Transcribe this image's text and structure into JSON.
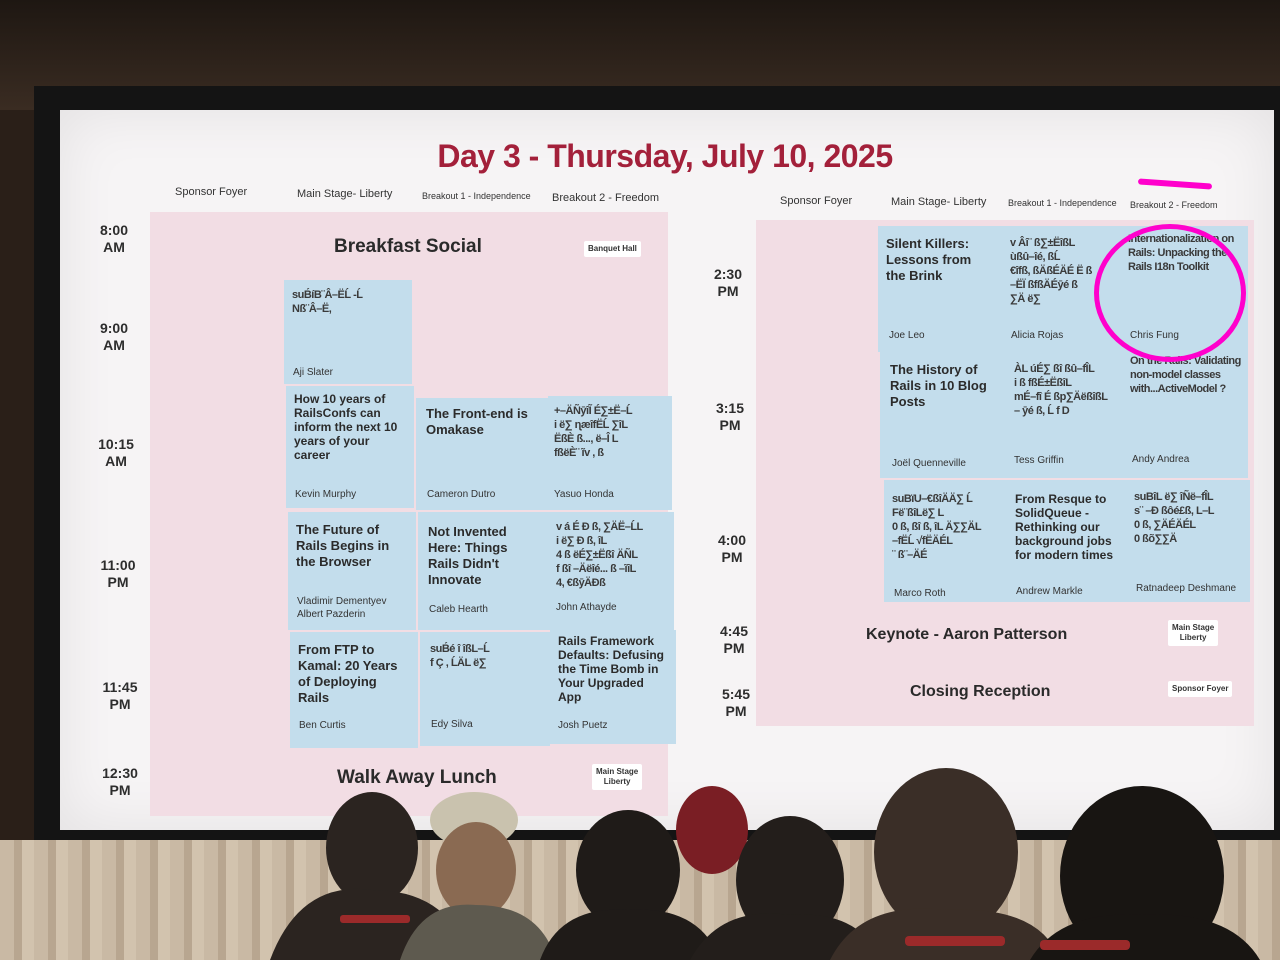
{
  "slide": {
    "title": "Day 3 - Thursday, July 10, 2025",
    "colors": {
      "title": "#a3203a",
      "session": "#c3ddec",
      "event": "#f2dde4",
      "annotation": "#ff00cc"
    },
    "headers_left": [
      "Sponsor Foyer",
      "Main Stage- Liberty",
      "Breakout 1 - Independence",
      "Breakout 2 - Freedom"
    ],
    "headers_right": [
      "Sponsor Foyer",
      "Main Stage- Liberty",
      "Breakout 1 - Independence",
      "Breakout 2 - Freedom"
    ],
    "times_left": [
      "8:00\nAM",
      "9:00\nAM",
      "10:15\nAM",
      "11:00\nPM",
      "11:45\nPM",
      "12:30\nPM"
    ],
    "times_right": [
      "2:30\nPM",
      "3:15\nPM",
      "4:00\nPM",
      "4:45\nPM",
      "5:45\nPM"
    ],
    "events": {
      "breakfast": "Breakfast Social",
      "breakfast_loc": "Banquet Hall",
      "lunch": "Walk Away Lunch",
      "lunch_loc": "Main Stage\nLiberty",
      "keynote": "Keynote - Aaron Patterson",
      "keynote_loc": "Main Stage\nLiberty",
      "closing": "Closing Reception",
      "closing_loc": "Sponsor Foyer"
    },
    "sessions_left": {
      "s1": {
        "title": "suB́íB¨Â–ËĹ -Ĺ\nNß¨Â–Ë,",
        "speaker": "Aji Slater"
      },
      "s2": {
        "title": "How 10 years of RailsConfs can inform the next 10 years of your career",
        "speaker": "Kevin Murphy"
      },
      "s3": {
        "title": "The Front-end is Omakase",
        "speaker": "Cameron Dutro"
      },
      "s4": {
        "title": "+–ÄÑȳîĨ É∑±Ë–Ĺ\ni ë∑ ɳæîfËĹ ∑îL\nËßÈ ß..., ë–Î L\nfßëÈ¨ ĩv , ß",
        "speaker": "Yasuo Honda"
      },
      "s5": {
        "title": "The Future of Rails Begins in the Browser",
        "speaker": "Vladimir Dementyev\nAlbert Pazderin"
      },
      "s6": {
        "title": "Not Invented Here: Things Rails Didn't Innovate",
        "speaker": "Caleb Hearth"
      },
      "s7": {
        "title": "v á É Ð ß, ∑ÄË–ĹL\ni ë∑ Ð ß, îL\n4 ß ëÉ∑±Ëßî ÄÑL\nf ßî –Äëîé... ß –ĩîL\n4, €ßȳÄÐß",
        "speaker": "John Athayde"
      },
      "s8": {
        "title": "From FTP to Kamal: 20 Years of Deploying Rails",
        "speaker": "Ben Curtis"
      },
      "s9": {
        "title": "suB́é î îßL–Ĺ\nf Ç , ĹÄL ë∑",
        "speaker": "Edy Silva"
      },
      "s10": {
        "title": "Rails Framework Defaults: Defusing the Time Bomb in Your Upgraded App",
        "speaker": "Josh Puetz"
      }
    },
    "sessions_right": {
      "r1": {
        "title": "Silent Killers: Lessons from the Brink",
        "speaker": "Joe Leo"
      },
      "r2": {
        "title": "v Âî¨ ß∑±ËîßL\nùßû–îé, ßĹ\n€îfß, ßÄßÉÄÉ Ë ß\n–ËÏ ßfßÄÉȳé ß\n∑Ä ë∑",
        "speaker": "Alicia Rojas"
      },
      "r3": {
        "title": "Internationalization on Rails: Unpacking the Rails I18n Toolkit",
        "speaker": "Chris Fung"
      },
      "r4": {
        "title": "The History of Rails in 10 Blog Posts",
        "speaker": "Joël Quenneville"
      },
      "r5": {
        "title": "ÀL úÉ∑ ßî ßû–fÎL\ni ß fßÉ±ËßîL\nmÉ–fî É ßp∑ÄëßîßL\n– ȳé ß, Ĺ f D",
        "speaker": "Tess Griffin"
      },
      "r6": {
        "title": "On the Rails: Validating non-model classes with...ActiveModel ?",
        "speaker": "Andy Andrea"
      },
      "r7": {
        "title": "suBïU–€ßîÄÄ∑ Ĺ\nFë¨ßîLë∑ L\n0 ß, ßî ß, îL Ä∑∑ÄL\n–fËĹ √fËÄÉL\n¨ ß¨–ÄÉ",
        "speaker": "Marco Roth"
      },
      "r8": {
        "title": "From Resque to SolidQueue - Rethinking our background jobs for modern times",
        "speaker": "Andrew Markle"
      },
      "r9": {
        "title": "suBîL ë∑ îÑë–fÎL\ns¨ –Ð ßôé£ß, L–L\n0 ß, ∑ÄÉÄÉL\n0 ßõ∑∑Ä",
        "speaker": "Ratnadeep Deshmane"
      }
    }
  }
}
